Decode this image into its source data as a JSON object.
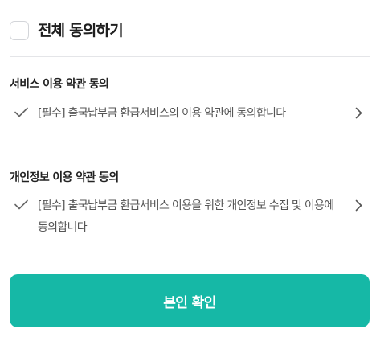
{
  "agree_all": {
    "label": "전체 동의하기",
    "checked": false
  },
  "terms": [
    {
      "section_title": "서비스 이용 약관 동의",
      "text": "[필수] 출국납부금 환급서비스의 이용 약관에 동의합니다",
      "check_icon": "checkmark-icon",
      "arrow_icon": "chevron-right-icon"
    },
    {
      "section_title": "개인정보 이용 약관 동의",
      "text": "[필수] 출국납부금 환급서비스 이용을 위한 개인정보 수집 및 이용에 동의합니다",
      "check_icon": "checkmark-icon",
      "arrow_icon": "chevron-right-icon"
    }
  ],
  "confirm_button": {
    "label": "본인 확인"
  },
  "colors": {
    "accent": "#16b8a6",
    "checkbox_border": "#d3d5d9",
    "divider": "#e4e5e8",
    "body_text": "#555555",
    "icon": "#666666"
  }
}
